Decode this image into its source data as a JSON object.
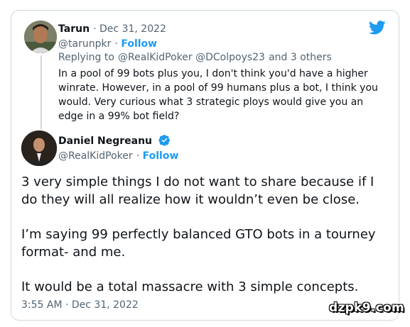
{
  "reply_tweet": {
    "name": "Tarun",
    "date": "Dec 31, 2022",
    "handle": "@tarunpkr",
    "follow": "Follow",
    "replying_label": "Replying to",
    "replying_users": "@RealKidPoker @DColpoys23",
    "replying_others": "and 3 others",
    "text": "In a pool of 99 bots plus you, I don't think you'd have a higher winrate. However, in a pool of 99 humans plus a bot, I think you would. Very curious what 3 strategic ploys would give you an edge in a 99% bot field?"
  },
  "main_tweet": {
    "name": "Daniel Negreanu",
    "handle": "@RealKidPoker",
    "follow": "Follow",
    "paragraphs": [
      "3 very simple things I do not want to share because if I do they will all realize how it wouldn’t even be close.",
      "I’m saying 99 perfectly balanced GTO bots in a tourney format- and me.",
      "It would be a total massacre with 3 simple concepts."
    ],
    "timestamp": "3:55 AM · Dec 31, 2022"
  },
  "watermark": "dzpk9.com",
  "colors": {
    "accent": "#1d9bf0",
    "muted": "#536471",
    "border": "#cfd9de"
  },
  "icons": [
    "twitter-bird-icon",
    "verified-badge-icon"
  ]
}
